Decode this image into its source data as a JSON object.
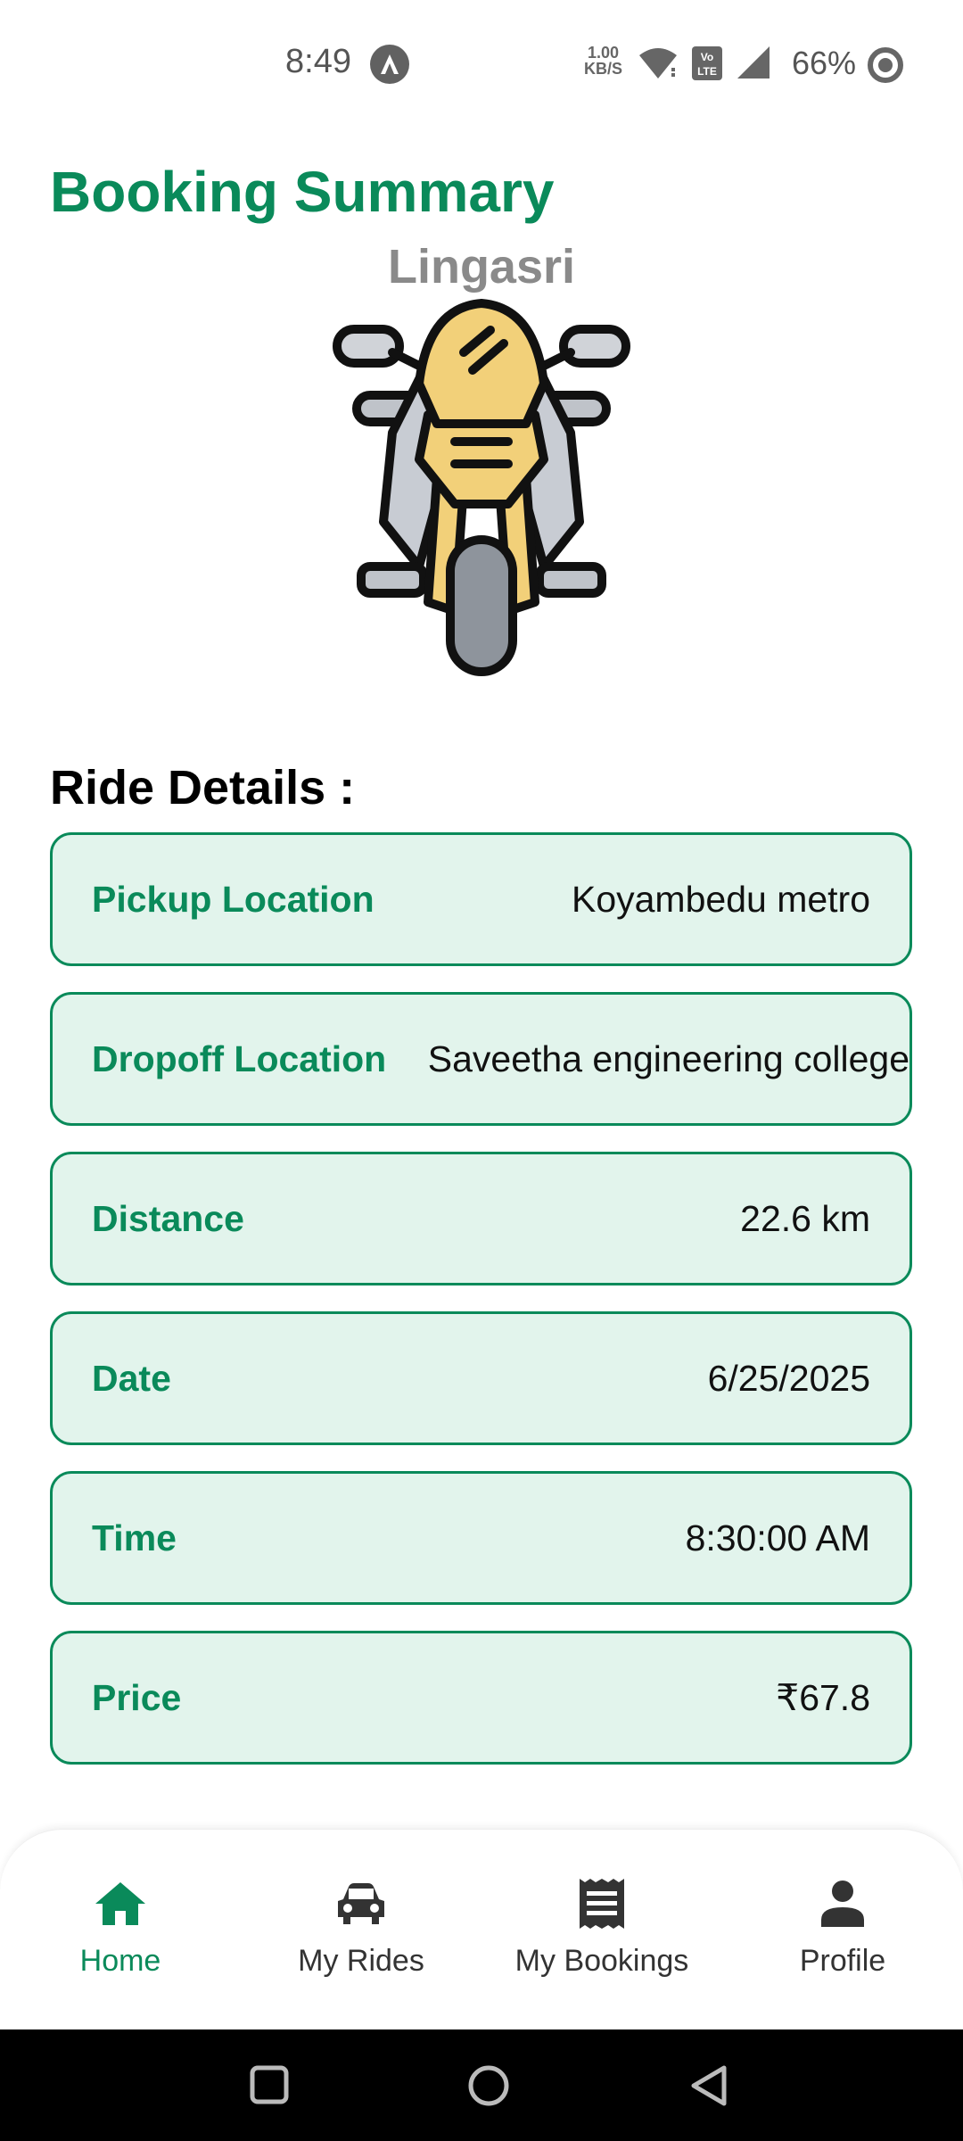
{
  "status_bar": {
    "time": "8:49",
    "speed_value": "1.00",
    "speed_unit": "KB/S",
    "battery": "66%",
    "icons": [
      "app-notification-icon",
      "wifi-icon",
      "volte-icon",
      "cell-signal-icon",
      "battery-saver-icon"
    ]
  },
  "header": {
    "title": "Booking Summary",
    "user_name": "Lingasri"
  },
  "vehicle": {
    "icon": "motorcycle-icon"
  },
  "ride_details": {
    "title": "Ride Details :",
    "rows": [
      {
        "label": "Pickup Location",
        "value": "Koyambedu metro"
      },
      {
        "label": "Dropoff Location",
        "value": "Saveetha engineering college"
      },
      {
        "label": "Distance",
        "value": "22.6 km"
      },
      {
        "label": "Date",
        "value": "6/25/2025"
      },
      {
        "label": "Time",
        "value": "8:30:00 AM"
      },
      {
        "label": "Price",
        "value": "₹67.8"
      }
    ]
  },
  "bottom_nav": {
    "items": [
      {
        "label": "Home",
        "icon": "home-icon",
        "active": true
      },
      {
        "label": "My Rides",
        "icon": "car-icon",
        "active": false
      },
      {
        "label": "My Bookings",
        "icon": "receipt-icon",
        "active": false
      },
      {
        "label": "Profile",
        "icon": "person-icon",
        "active": false
      }
    ]
  },
  "colors": {
    "accent": "#0a8a5a",
    "row_background": "#e2f4ec",
    "name_gray": "#8a8a8a"
  }
}
